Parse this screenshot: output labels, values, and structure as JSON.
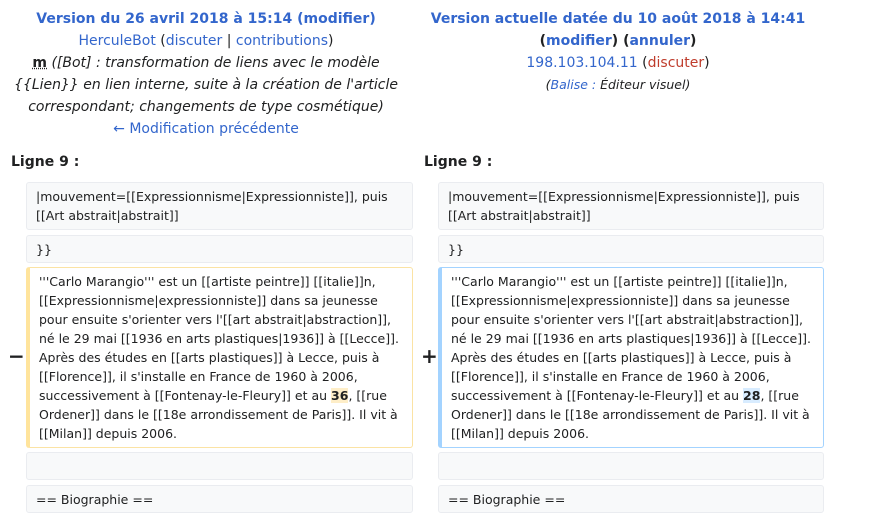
{
  "left_header": {
    "title_prefix": "Version du 26 avril 2018 à 15:14",
    "open_paren": " (",
    "modify": "modifier",
    "close_paren": ")",
    "user": "HerculeBot",
    "talk_open": " (",
    "talk": "discuter",
    "sep": " | ",
    "contribs": "contributions",
    "talk_close": ")",
    "minor_mark": "m",
    "summary_line1": " ([Bot] : transformation de liens avec le modèle",
    "summary_line2": "{{Lien}} en lien interne, suite à la création de l'article",
    "summary_line3": "correspondant; changements de type cosmétique)",
    "prev_edit": "← Modification précédente"
  },
  "right_header": {
    "title": "Version actuelle datée du 10 août 2018 à 14:41",
    "modify": "modifier",
    "undo": "annuler",
    "p1": "(",
    "p2": ") (",
    "p3": ")",
    "ip": "198.103.104.11",
    "talk_open": " (",
    "talk": "discuter",
    "talk_close": ")",
    "tag_open": "(",
    "tag_label": "Balise : ",
    "tag_value": "Éditeur visuel",
    "tag_close": ")"
  },
  "left_line_label": "Ligne 9 :",
  "right_line_label": "Ligne 9 :",
  "markers": {
    "minus": "−",
    "plus": "+"
  },
  "context": {
    "row1_line1": "|mouvement=[[Expressionnisme|Expressionniste]], puis",
    "row1_line2": "[[Art abstrait|abstrait]]",
    "row2": "}}",
    "row4": "",
    "row5": "== Biographie =="
  },
  "diff_lines": [
    "'''Carlo Marangio''' est un [[artiste peintre]] [[italie]]n,",
    "[[Expressionnisme|expressionniste]] dans sa jeunesse",
    "pour ensuite s'orienter vers l'[[art abstrait|abstraction]],",
    "né le 29 mai [[1936 en arts plastiques|1936]] à [[Lecce]].",
    "Après des études en [[arts plastiques]] à Lecce, puis à",
    "[[Florence]], il s'installe en France de 1960 à 2006,"
  ],
  "diff_line7_prefix": "successivement à [[Fontenay-le-Fleury]] et au ",
  "diff_line7_suffix": ", [[rue",
  "old_number": "36",
  "new_number": "28",
  "diff_tail": [
    "Ordener]] dans le [[18e arrondissement de Paris]]. Il vit à",
    "[[Milan]] depuis 2006."
  ]
}
